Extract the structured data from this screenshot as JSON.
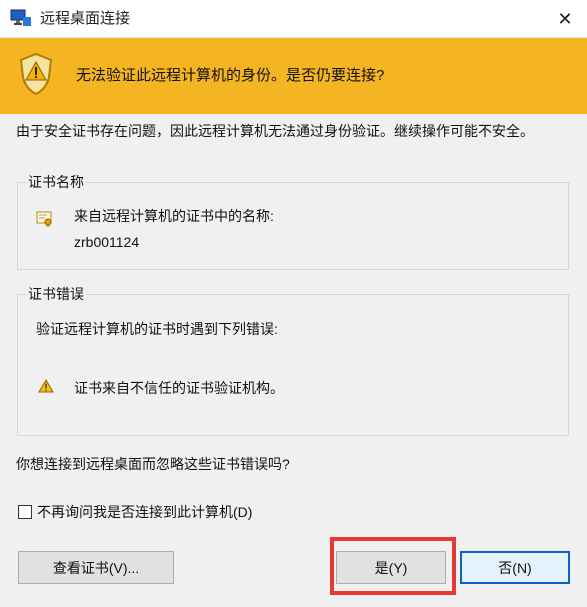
{
  "window": {
    "title": "远程桌面连接",
    "close_symbol": "✕"
  },
  "banner": {
    "icon": "shield-warning-icon",
    "text": "无法验证此远程计算机的身份。是否仍要连接?"
  },
  "description": "由于安全证书存在问题，因此远程计算机无法通过身份验证。继续操作可能不安全。",
  "certificate_group": {
    "legend": "证书名称",
    "icon": "certificate-icon",
    "line1": "来自远程计算机的证书中的名称:",
    "line2": "zrb001124"
  },
  "error_group": {
    "legend": "证书错误",
    "intro": "验证远程计算机的证书时遇到下列错误:",
    "icon": "warning-icon",
    "item": "证书来自不信任的证书验证机构。"
  },
  "question": "你想连接到远程桌面而忽略这些证书错误吗?",
  "checkbox": {
    "checked": false,
    "label": "不再询问我是否连接到此计算机(D)"
  },
  "buttons": {
    "view_cert": "查看证书(V)...",
    "yes": "是(Y)",
    "no": "否(N)"
  },
  "colors": {
    "banner": "#f5b422",
    "highlight": "#e53935",
    "default_button_border": "#0b61c6"
  }
}
